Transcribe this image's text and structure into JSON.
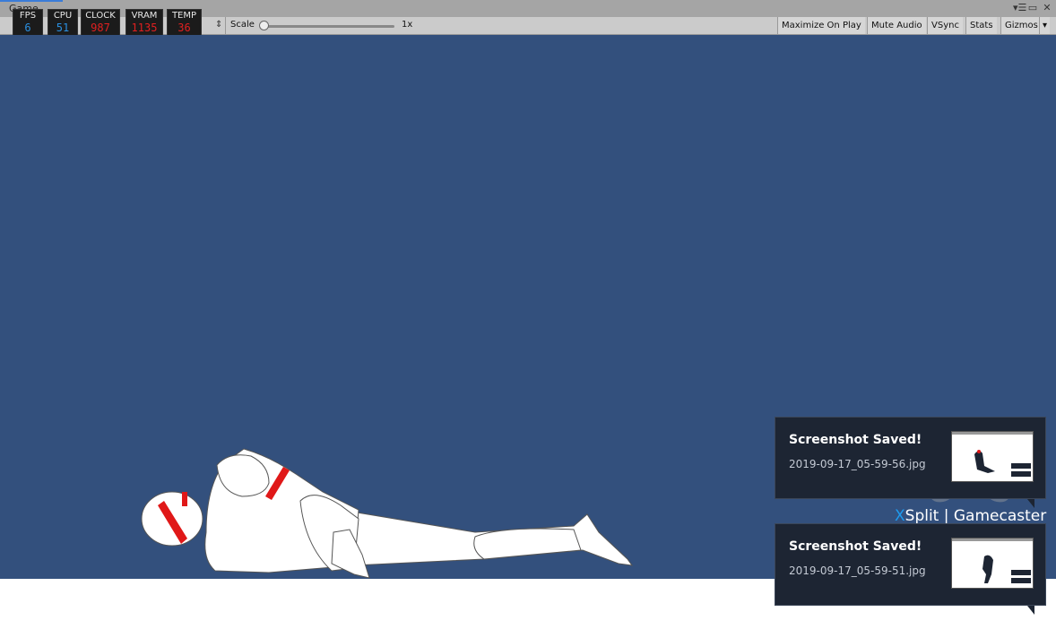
{
  "window": {
    "tab_label": "Game",
    "controls": [
      "▾☰",
      "▭",
      "✕"
    ]
  },
  "toolbar": {
    "display_dropdown_arrow": "⇕",
    "scale_label": "Scale",
    "scale_value": "1x",
    "scale_fraction": 0.02,
    "buttons": {
      "maximize_on_play": "Maximize On Play",
      "mute_audio": "Mute Audio",
      "vsync": "VSync",
      "stats": "Stats",
      "gizmos": "Gizmos"
    },
    "gizmos_arrow": "▾"
  },
  "stats_overlay": {
    "fps": {
      "label": "FPS",
      "value": "6"
    },
    "cpu": {
      "label": "CPU",
      "value": "51"
    },
    "clock": {
      "label": "CLOCK",
      "value": "987"
    },
    "vram": {
      "label": "VRAM",
      "value": "1135"
    },
    "temp": {
      "label": "TEMP",
      "value": "36"
    },
    "colors": {
      "fps": "#2a8fe0",
      "cpu": "#2a8fe0",
      "clock": "#e02020",
      "vram": "#e02020",
      "temp": "#e02020"
    }
  },
  "game_view": {
    "background": "#33507d"
  },
  "xsplit": {
    "brand_x": "X",
    "brand_rest": "Split | Gamecaster",
    "watermark_icon": "gamepad-icon",
    "toasts": [
      {
        "title": "Screenshot Saved!",
        "filename": "2019-09-17_05-59-56.jpg"
      },
      {
        "title": "Screenshot Saved!",
        "filename": "2019-09-17_05-59-51.jpg"
      }
    ]
  }
}
